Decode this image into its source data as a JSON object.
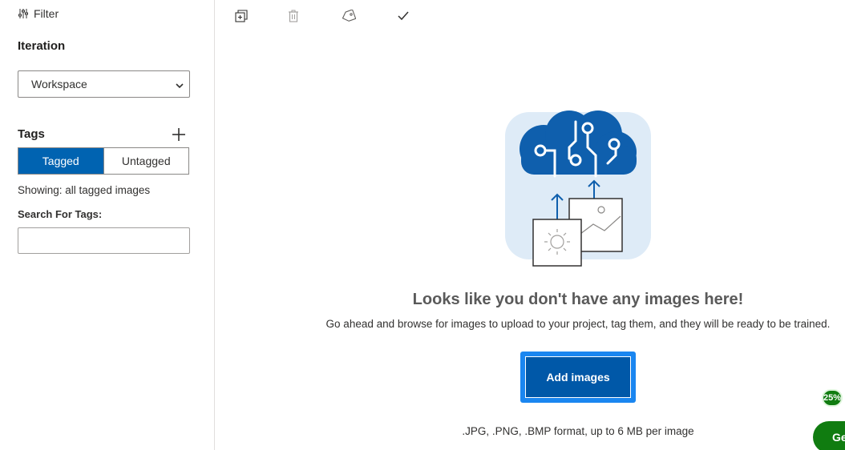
{
  "sidebar": {
    "filter_label": "Filter",
    "iteration_title": "Iteration",
    "iteration_select": {
      "selected": "Workspace"
    },
    "tags_title": "Tags",
    "tag_toggle": {
      "tagged_label": "Tagged",
      "untagged_label": "Untagged",
      "active": "Tagged"
    },
    "showing_text": "Showing: all tagged images",
    "search_label": "Search For Tags:",
    "search_value": ""
  },
  "toolbar": {
    "icons": [
      "copy-add-icon",
      "trash-icon",
      "tag-icon",
      "checkmark-icon"
    ]
  },
  "empty_state": {
    "title": "Looks like you don't have any images here!",
    "description": "Go ahead and browse for images to upload to your project, tag them, and they will be ready to be trained.",
    "button_label": "Add images",
    "format_note": ".JPG, .PNG, .BMP format, up to 6 MB per image"
  },
  "floating": {
    "progress_badge": "25%",
    "get_started_label": "Ge"
  },
  "colors": {
    "primary": "#0063b1",
    "button_highlight": "#1a86f0",
    "success_green": "#107c10",
    "illustration_bg": "#deebf7",
    "cloud_blue": "#0f5fad"
  }
}
